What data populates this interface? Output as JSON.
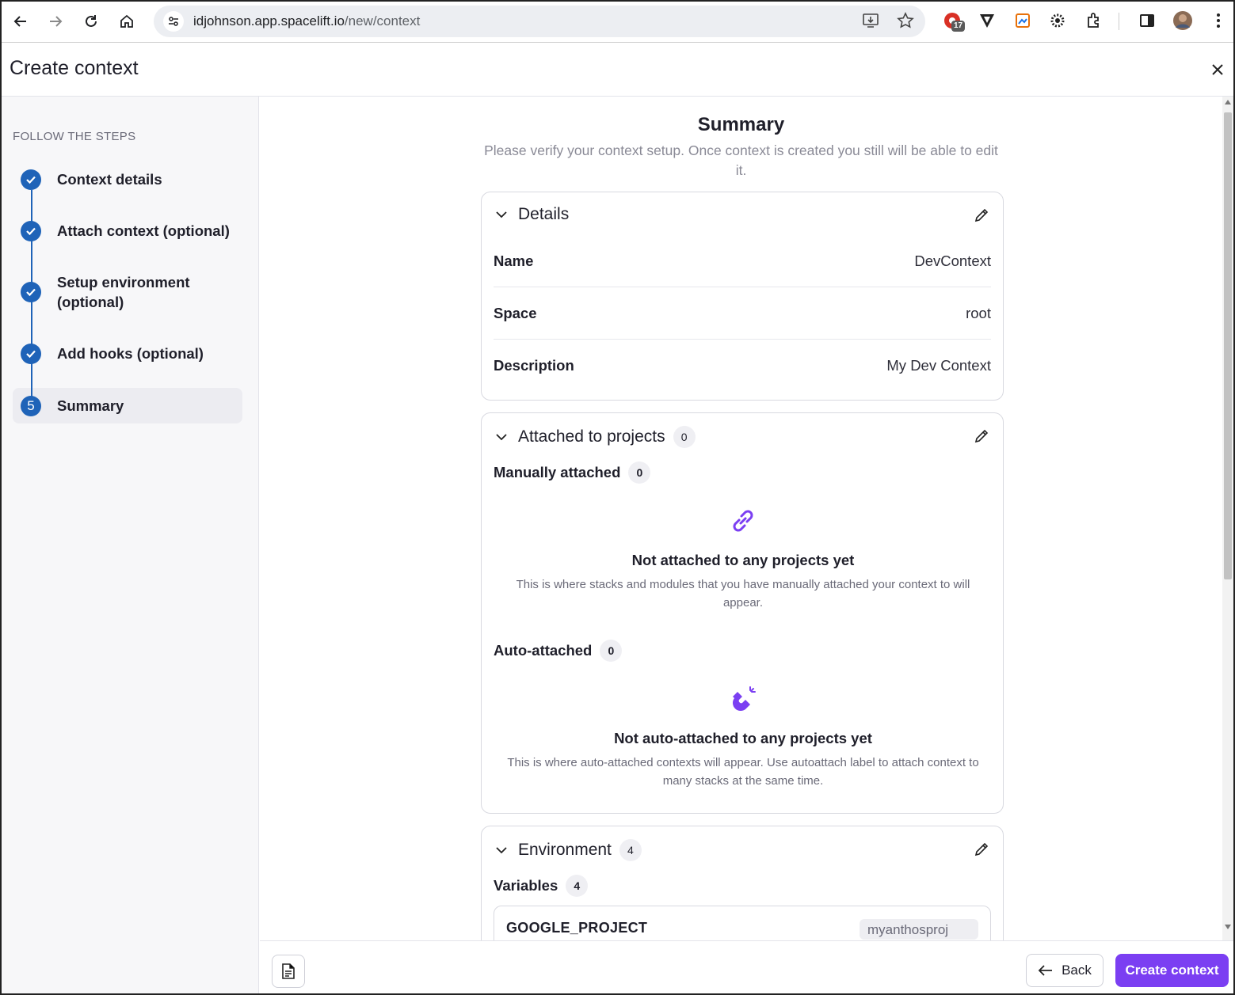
{
  "browser": {
    "url_host": "idjohnson.app.spacelift.io",
    "url_path": "/new/context",
    "ext_badge": "17"
  },
  "header": {
    "title": "Create context"
  },
  "sidebar": {
    "heading": "FOLLOW THE STEPS",
    "steps": [
      {
        "label": "Context details",
        "status": "done"
      },
      {
        "label": "Attach context (optional)",
        "status": "done"
      },
      {
        "label": "Setup environment (optional)",
        "status": "done"
      },
      {
        "label": "Add hooks (optional)",
        "status": "done"
      },
      {
        "label": "Summary",
        "status": "current",
        "number": "5"
      }
    ]
  },
  "summary": {
    "title": "Summary",
    "subtitle": "Please verify your context setup. Once context is created you still will be able to edit it.",
    "details": {
      "title": "Details",
      "rows": [
        {
          "key": "Name",
          "value": "DevContext"
        },
        {
          "key": "Space",
          "value": "root"
        },
        {
          "key": "Description",
          "value": "My Dev Context"
        }
      ]
    },
    "attached": {
      "title": "Attached to projects",
      "count": "0",
      "manual": {
        "label": "Manually attached",
        "count": "0",
        "empty_title": "Not attached to any projects yet",
        "empty_desc": "This is where stacks and modules that you have manually attached your context to will appear."
      },
      "auto": {
        "label": "Auto-attached",
        "count": "0",
        "empty_title": "Not auto-attached to any projects yet",
        "empty_desc": "This is where auto-attached contexts will appear. Use autoattach label to attach context to many stacks at the same time."
      }
    },
    "environment": {
      "title": "Environment",
      "count": "4",
      "variables_label": "Variables",
      "variables_count": "4",
      "first_var_name": "GOOGLE_PROJECT",
      "first_var_value": "myanthosproj"
    }
  },
  "footer": {
    "back_label": "Back",
    "create_label": "Create context"
  },
  "colors": {
    "accent": "#7b3ff2",
    "step_blue": "#1f63b8"
  }
}
